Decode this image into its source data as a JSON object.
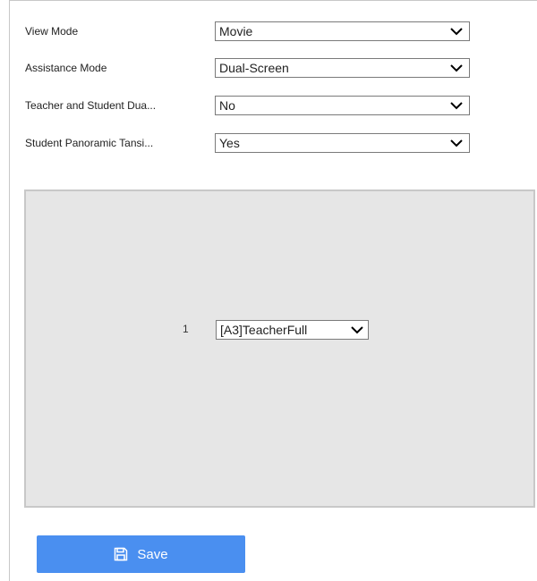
{
  "settings": [
    {
      "label": "View Mode",
      "value": "Movie"
    },
    {
      "label": "Assistance Mode",
      "value": "Dual-Screen"
    },
    {
      "label": "Teacher and Student Dua...",
      "value": "No"
    },
    {
      "label": "Student Panoramic Tansi...",
      "value": "Yes"
    }
  ],
  "preview": {
    "window_number": "1",
    "window_source": "[A3]TeacherFull"
  },
  "actions": {
    "save_label": "Save"
  },
  "icons": {
    "dropdown": "chevron-down-icon",
    "save": "floppy-disk-icon"
  },
  "colors": {
    "save_button": "#4a8ff0",
    "preview_bg": "#e6e6e6"
  }
}
